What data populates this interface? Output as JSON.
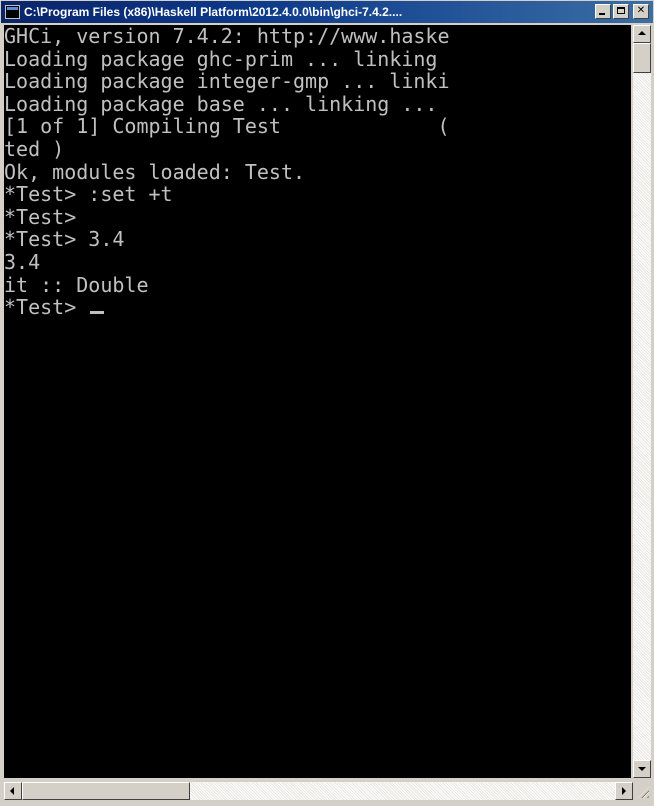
{
  "window": {
    "title": "C:\\Program Files (x86)\\Haskell Platform\\2012.4.0.0\\bin\\ghci-7.4.2...."
  },
  "console": {
    "lines": [
      "GHCi, version 7.4.2: http://www.haske",
      "Loading package ghc-prim ... linking ",
      "Loading package integer-gmp ... linki",
      "Loading package base ... linking ... ",
      "[1 of 1] Compiling Test             (",
      "ted )",
      "Ok, modules loaded: Test.",
      "*Test> :set +t",
      "*Test>",
      "*Test> 3.4",
      "3.4",
      "it :: Double",
      "*Test> "
    ]
  },
  "colors": {
    "console_background": "#000000",
    "console_text": "#c0c0c0",
    "titlebar_start": "#0a246a",
    "titlebar_end": "#3a6ea5"
  },
  "icons": {
    "window": "console-app-icon",
    "minimize": "minimize-icon",
    "maximize": "maximize-icon",
    "close": "close-icon"
  }
}
